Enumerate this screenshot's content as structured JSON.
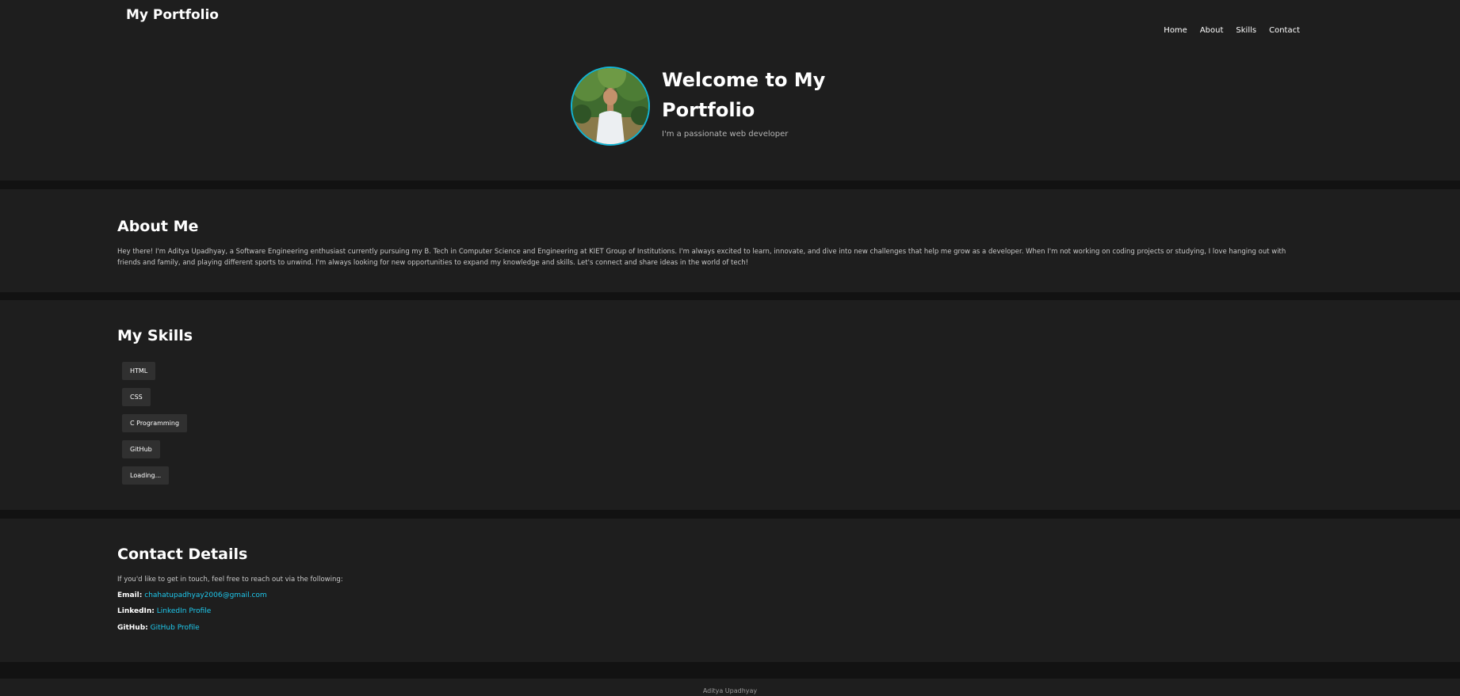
{
  "header": {
    "brand": "My Portfolio",
    "nav": [
      "Home",
      "About",
      "Skills",
      "Contact"
    ]
  },
  "hero": {
    "title": "Welcome to My Portfolio",
    "tagline": "I'm a passionate web developer"
  },
  "about": {
    "title": "About Me",
    "text": "Hey there! I'm Aditya Upadhyay, a Software Engineering enthusiast currently pursuing my B. Tech in Computer Science and Engineering at KIET Group of Institutions. I'm always excited to learn, innovate, and dive into new challenges that help me grow as a developer. When I'm not working on coding projects or studying, I love hanging out with friends and family, and playing different sports to unwind. I'm always looking for new opportunities to expand my knowledge and skills. Let's connect and share ideas in the world of tech!"
  },
  "skills": {
    "title": "My Skills",
    "items": [
      "HTML",
      "CSS",
      "C Programming",
      "GitHub",
      "Loading..."
    ]
  },
  "contact": {
    "title": "Contact Details",
    "intro": "If you'd like to get in touch, feel free to reach out via the following:",
    "email_label": "Email:",
    "email_value": "chahatupadhyay2006@gmail.com",
    "linkedin_label": "LinkedIn:",
    "linkedin_value": "LinkedIn Profile",
    "github_label": "GitHub:",
    "github_value": "GitHub Profile"
  },
  "footer": {
    "text": "Aditya Upadhyay"
  },
  "colors": {
    "page_bg": "#121212",
    "section_bg": "#1e1e1e",
    "skill_bg": "#303030",
    "link": "#1ec8ec",
    "avatar_border": "#13b5d6"
  },
  "icons": {
    "avatar": "profile-photo"
  }
}
